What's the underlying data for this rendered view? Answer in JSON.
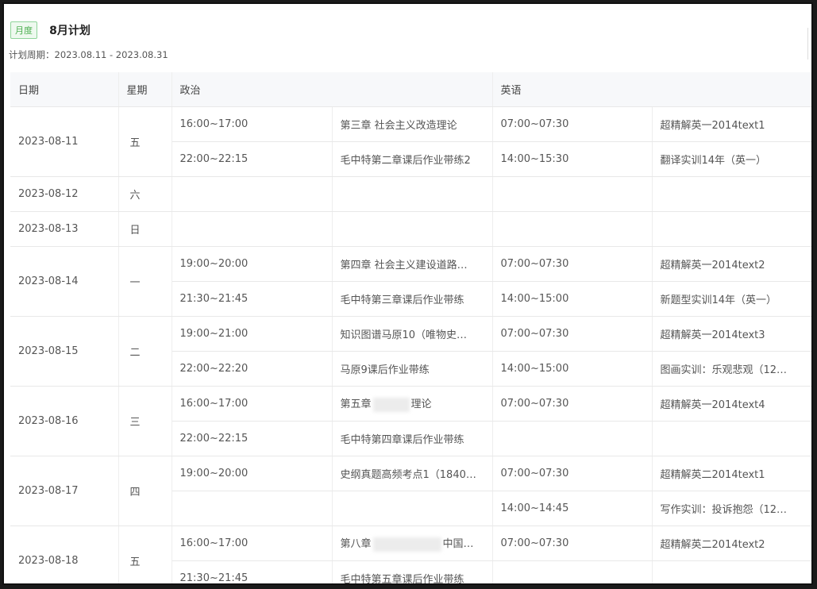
{
  "header": {
    "tag": "月度",
    "title": "8月计划",
    "period": "计划周期：2023.08.11 - 2023.08.31"
  },
  "columns": {
    "date": "日期",
    "week": "星期",
    "politics": "政治",
    "english": "英语"
  },
  "rows": [
    {
      "date": "2023-08-11",
      "week": "五",
      "items": [
        {
          "pt": "16:00~17:00",
          "pn": "第三章 社会主义改造理论",
          "et": "07:00~07:30",
          "en": "超精解英一2014text1"
        },
        {
          "pt": "22:00~22:15",
          "pn": "毛中特第二章课后作业带练2",
          "et": "14:00~15:30",
          "en": "翻译实训14年（英一）"
        }
      ]
    },
    {
      "date": "2023-08-12",
      "week": "六",
      "items": [
        {
          "pt": "",
          "pn": "",
          "et": "",
          "en": ""
        }
      ]
    },
    {
      "date": "2023-08-13",
      "week": "日",
      "items": [
        {
          "pt": "",
          "pn": "",
          "et": "",
          "en": ""
        }
      ]
    },
    {
      "date": "2023-08-14",
      "week": "一",
      "items": [
        {
          "pt": "19:00~20:00",
          "pn": "第四章 社会主义建设道路…",
          "et": "07:00~07:30",
          "en": "超精解英一2014text2"
        },
        {
          "pt": "21:30~21:45",
          "pn": "毛中特第三章课后作业带练",
          "et": "14:00~15:00",
          "en": "新题型实训14年（英一）"
        }
      ]
    },
    {
      "date": "2023-08-15",
      "week": "二",
      "items": [
        {
          "pt": "19:00~21:00",
          "pn": "知识图谱马原10（唯物史…",
          "et": "07:00~07:30",
          "en": "超精解英一2014text3"
        },
        {
          "pt": "22:00~22:20",
          "pn": "马原9课后作业带练",
          "et": "14:00~15:00",
          "en": "图画实训：乐观悲观（12…"
        }
      ]
    },
    {
      "date": "2023-08-16",
      "week": "三",
      "items": [
        {
          "pt": "16:00~17:00",
          "pn": "第五章",
          "pn2": "理论",
          "blur": 1,
          "et": "07:00~07:30",
          "en": "超精解英一2014text4"
        },
        {
          "pt": "22:00~22:15",
          "pn": "毛中特第四章课后作业带练",
          "et": "",
          "en": ""
        }
      ]
    },
    {
      "date": "2023-08-17",
      "week": "四",
      "items": [
        {
          "pt": "19:00~20:00",
          "pn": "史纲真题高频考点1（1840…",
          "et": "07:00~07:30",
          "en": "超精解英二2014text1"
        },
        {
          "pt": "",
          "pn": "",
          "et": "14:00~14:45",
          "en": "写作实训：投诉抱怨（12…"
        }
      ]
    },
    {
      "date": "2023-08-18",
      "week": "五",
      "items": [
        {
          "pt": "16:00~17:00",
          "pn": "第八章",
          "pn2": "中国…",
          "blur": 2,
          "et": "07:00~07:30",
          "en": "超精解英二2014text2"
        },
        {
          "pt": "21:30~21:45",
          "pn": "毛中特第五章课后作业带练",
          "et": "",
          "en": ""
        }
      ]
    }
  ]
}
